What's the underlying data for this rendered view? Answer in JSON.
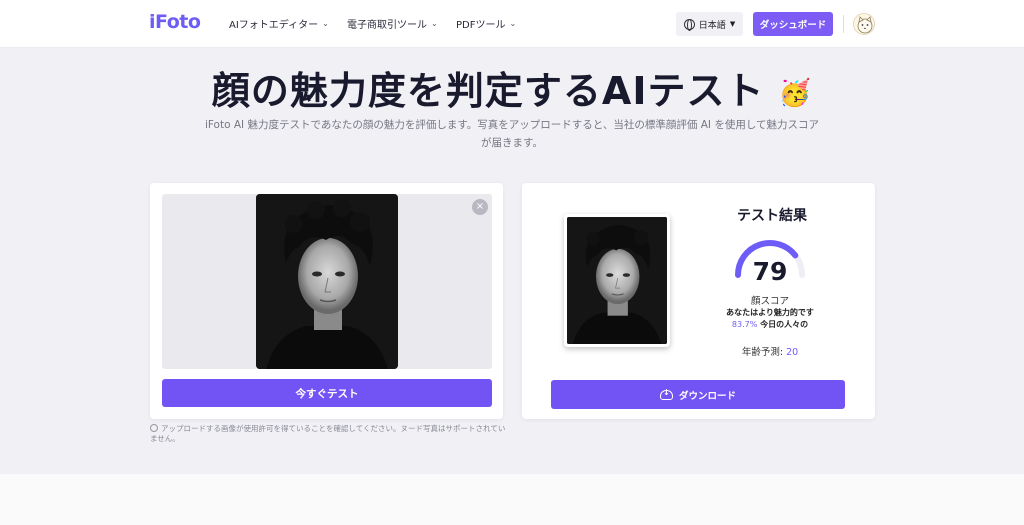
{
  "header": {
    "logo": "iFoto",
    "nav": [
      {
        "label": "AIフォトエディター"
      },
      {
        "label": "電子商取引ツール"
      },
      {
        "label": "PDFツール"
      }
    ],
    "language": "日本語",
    "dashboard_label": "ダッシュボード"
  },
  "hero": {
    "title": "顔の魅力度を判定するAIテスト",
    "emoji": "🥳",
    "description": "iFoto AI 魅力度テストであなたの顔の魅力を評価します。写真をアップロードすると、当社の標準顔評価 AI を使用して魅力スコアが届きます。"
  },
  "upload": {
    "close_label": "×",
    "test_button": "今すぐテスト",
    "disclaimer": "アップロードする画像が使用許可を得ていることを確認してください。ヌード写真はサポートされていません。"
  },
  "result": {
    "title": "テスト結果",
    "score": "79",
    "score_value": 79,
    "score_max": 100,
    "score_label": "顔スコア",
    "desc_prefix": "あなたはより魅力的です",
    "desc_pct": "83.7%",
    "desc_suffix": "今日の人々の",
    "age_label": "年齢予測:",
    "age_value": "20",
    "download_label": "ダウンロード"
  },
  "colors": {
    "accent": "#7254f5",
    "logo": "#6e5cf6",
    "background": "#f0f0f5"
  }
}
